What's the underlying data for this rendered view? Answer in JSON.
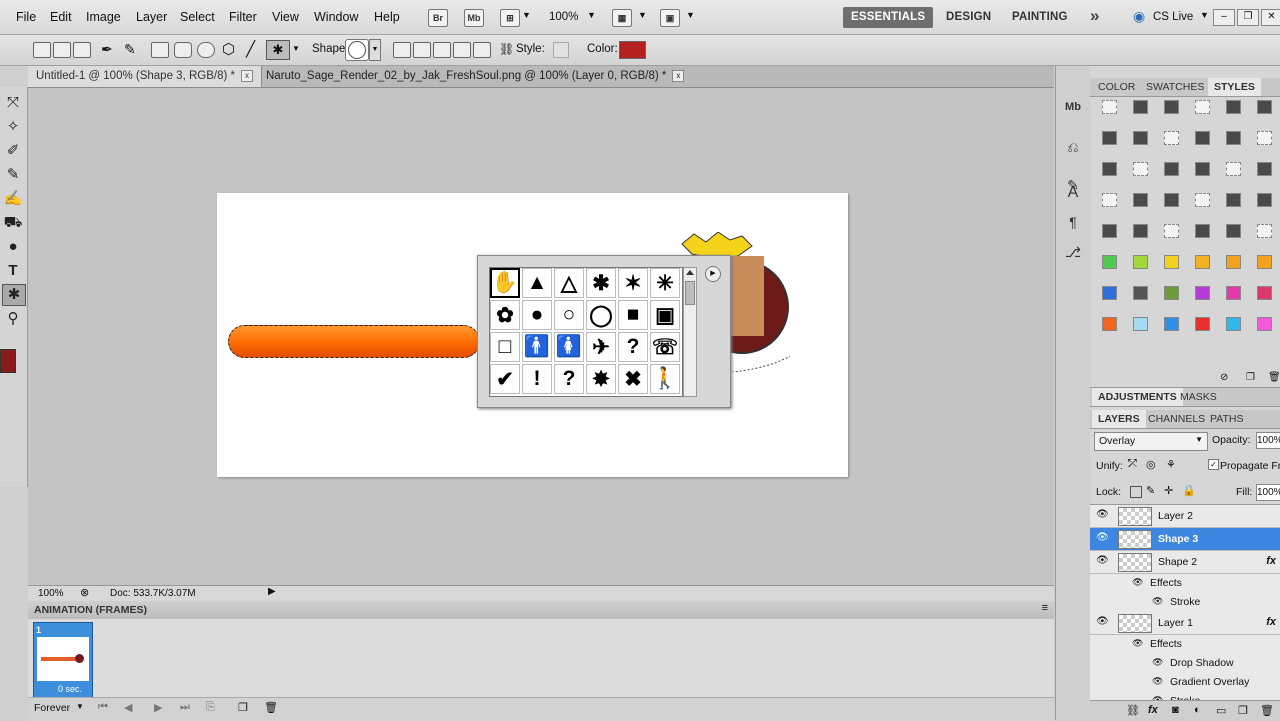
{
  "menubar": {
    "items": [
      "File",
      "Edit",
      "Image",
      "Layer",
      "Select",
      "Filter",
      "View",
      "Window",
      "Help"
    ],
    "icons": [
      "Br",
      "Mb"
    ],
    "zoom": "100%",
    "workspaces": [
      "ESSENTIALS",
      "DESIGN",
      "PAINTING"
    ],
    "more": "»",
    "cslive": "CS Live"
  },
  "options": {
    "shape_label": "Shape:",
    "style_label": "Style:",
    "color_label": "Color:",
    "color_value": "#b52020"
  },
  "tabs": [
    {
      "label": "Untitled-1 @ 100% (Shape 3, RGB/8) *"
    },
    {
      "label": "Naruto_Sage_Render_02_by_Jak_FreshSoul.png @ 100% (Layer 0, RGB/8) *"
    }
  ],
  "tab_close": "x",
  "status": {
    "zoom": "100%",
    "doc": "Doc: 533.7K/3.07M"
  },
  "animation": {
    "title": "ANIMATION (FRAMES)",
    "frame_num": "1",
    "frame_delay": "0 sec.",
    "loop": "Forever"
  },
  "panels": {
    "top_tabs": [
      "COLOR",
      "SWATCHES",
      "STYLES"
    ],
    "mid_tabs": [
      "ADJUSTMENTS",
      "MASKS"
    ],
    "layer_tabs": [
      "LAYERS",
      "CHANNELS",
      "PATHS"
    ],
    "blend": "Overlay",
    "opacity_label": "Opacity:",
    "opacity_value": "100%",
    "unify_label": "Unify:",
    "propagate_label": "Propagate Fr",
    "lock_label": "Lock:",
    "fill_label": "Fill:",
    "fill_value": "100%"
  },
  "layers": [
    {
      "name": "Layer 2",
      "fx": "",
      "selected": false
    },
    {
      "name": "Shape 3",
      "fx": "",
      "selected": true
    },
    {
      "name": "Shape 2",
      "fx": "fx",
      "selected": false
    }
  ],
  "layer1": {
    "name": "Layer 1",
    "fx": "fx"
  },
  "effects_label": "Effects",
  "shape2_effects": [
    "Stroke"
  ],
  "layer1_effects": [
    "Drop Shadow",
    "Gradient Overlay",
    "Stroke"
  ],
  "swatch_colors": [
    "#4fc94f",
    "#a3d93a",
    "#f2d21f",
    "#f2b21f",
    "#f2a21f",
    "#f2a21f",
    "#2f6fd9",
    "#555555",
    "#6b9c3a",
    "#b43ad9",
    "#e23aa8",
    "#d93a6b",
    "#f2661f",
    "#a8d9f2",
    "#2f8fe6",
    "#e62f2f",
    "#2fb9e6",
    "#f25ad9"
  ],
  "shapes": [
    "✋",
    "▲",
    "△",
    "✱",
    "✶",
    "✳",
    "✿",
    "●",
    "○",
    "◯",
    "■",
    "▣",
    "□",
    "🚹",
    "🚺",
    "✈",
    "?",
    "☏",
    "✔",
    "!",
    "?",
    "✸",
    "✖",
    "🚶"
  ]
}
